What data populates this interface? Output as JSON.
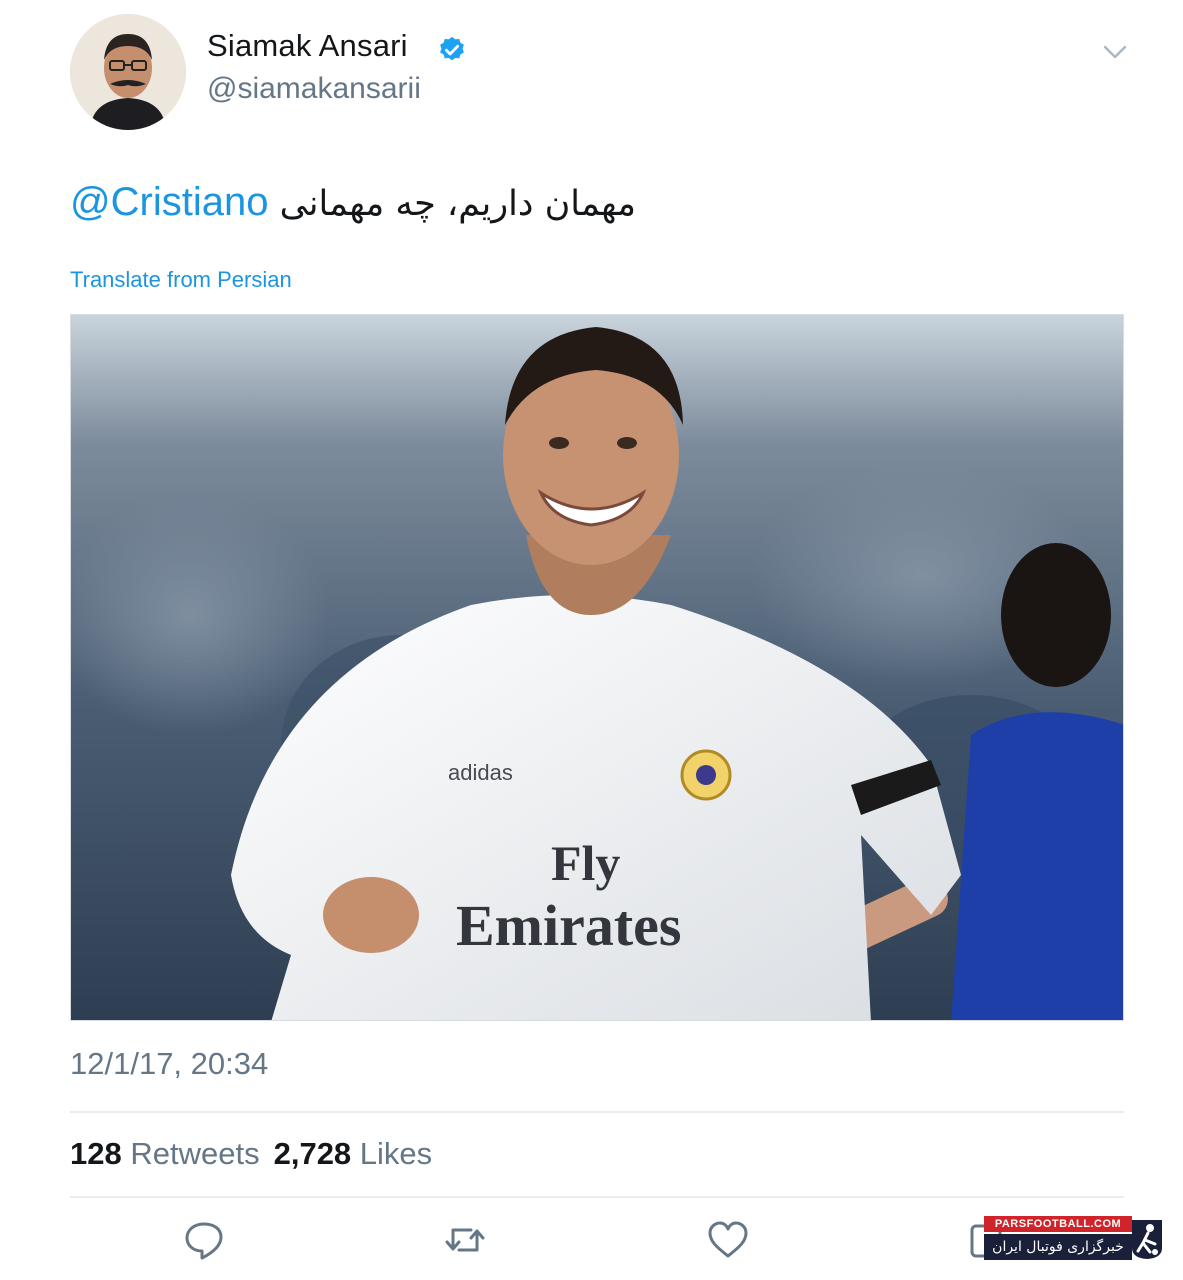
{
  "user": {
    "display_name": "Siamak Ansari",
    "handle": "@siamakansarii",
    "verified": true
  },
  "tweet": {
    "text_persian": "مهمان داریم، چه مهمانی",
    "mention": "@Cristiano",
    "translate_label": "Translate from Persian",
    "timestamp": "12/1/17, 20:34"
  },
  "photo": {
    "jersey_text_line1": "Fly",
    "jersey_text_line2": "Emirates",
    "brand_text": "adidas"
  },
  "stats": {
    "retweets_count": "128",
    "retweets_label": "Retweets",
    "likes_count": "2,728",
    "likes_label": "Likes"
  },
  "actions": [
    {
      "icon": "reply-icon"
    },
    {
      "icon": "retweet-icon"
    },
    {
      "icon": "like-icon"
    },
    {
      "icon": "share-icon"
    }
  ],
  "watermark": {
    "site": "PARSFOOTBALL.COM",
    "tagline": "خبرگزاری فوتبال ایران"
  },
  "colors": {
    "link": "#1b95e0",
    "secondary_text": "#657786",
    "primary_text": "#14171a",
    "divider": "#e6ecf0",
    "verified": "#1da1f2"
  }
}
